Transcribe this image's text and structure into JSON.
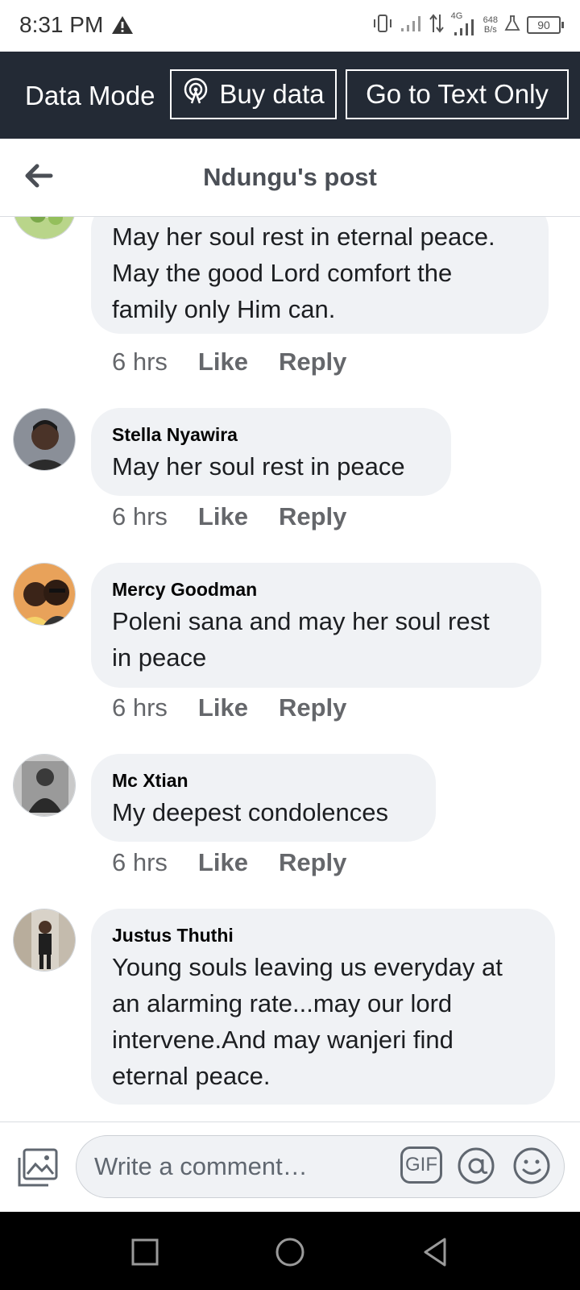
{
  "status_bar": {
    "time": "8:31 PM",
    "network_type": "4G",
    "speed_value": "648",
    "speed_unit": "B/s",
    "battery": "90",
    "icons": [
      "warning-icon",
      "vibrate-icon",
      "signal-icon",
      "data-transfer-icon",
      "signal-4g-icon",
      "flask-icon",
      "battery-icon"
    ]
  },
  "data_mode_bar": {
    "label": "Data Mode",
    "buy_label": "Buy data",
    "text_only_label": "Go to Text Only"
  },
  "header": {
    "title": "Ndungu's post"
  },
  "comments": [
    {
      "author": "",
      "lines": [
        "May her soul rest in eternal peace.",
        "May the good Lord comfort the",
        "family only Him can."
      ],
      "time": "6 hrs",
      "like": "Like",
      "reply": "Reply"
    },
    {
      "author": "Stella Nyawira",
      "lines": [
        "May her soul rest in peace"
      ],
      "time": "6 hrs",
      "like": "Like",
      "reply": "Reply"
    },
    {
      "author": "Mercy Goodman",
      "lines": [
        "Poleni sana and may her soul rest",
        "in peace"
      ],
      "time": "6 hrs",
      "like": "Like",
      "reply": "Reply"
    },
    {
      "author": "Mc Xtian",
      "lines": [
        "My deepest condolences"
      ],
      "time": "6 hrs",
      "like": "Like",
      "reply": "Reply"
    },
    {
      "author": "Justus Thuthi",
      "lines": [
        "Young souls leaving us everyday at",
        "an alarming rate...may our lord",
        "intervene.And may wanjeri find",
        "eternal peace."
      ]
    }
  ],
  "compose": {
    "placeholder": "Write a comment…",
    "gif_label": "GIF"
  },
  "colors": {
    "data_bar_bg": "#232a35",
    "bubble_bg": "#f0f2f5",
    "secondary_text": "#65676b",
    "nav_bar_bg": "#000000"
  }
}
